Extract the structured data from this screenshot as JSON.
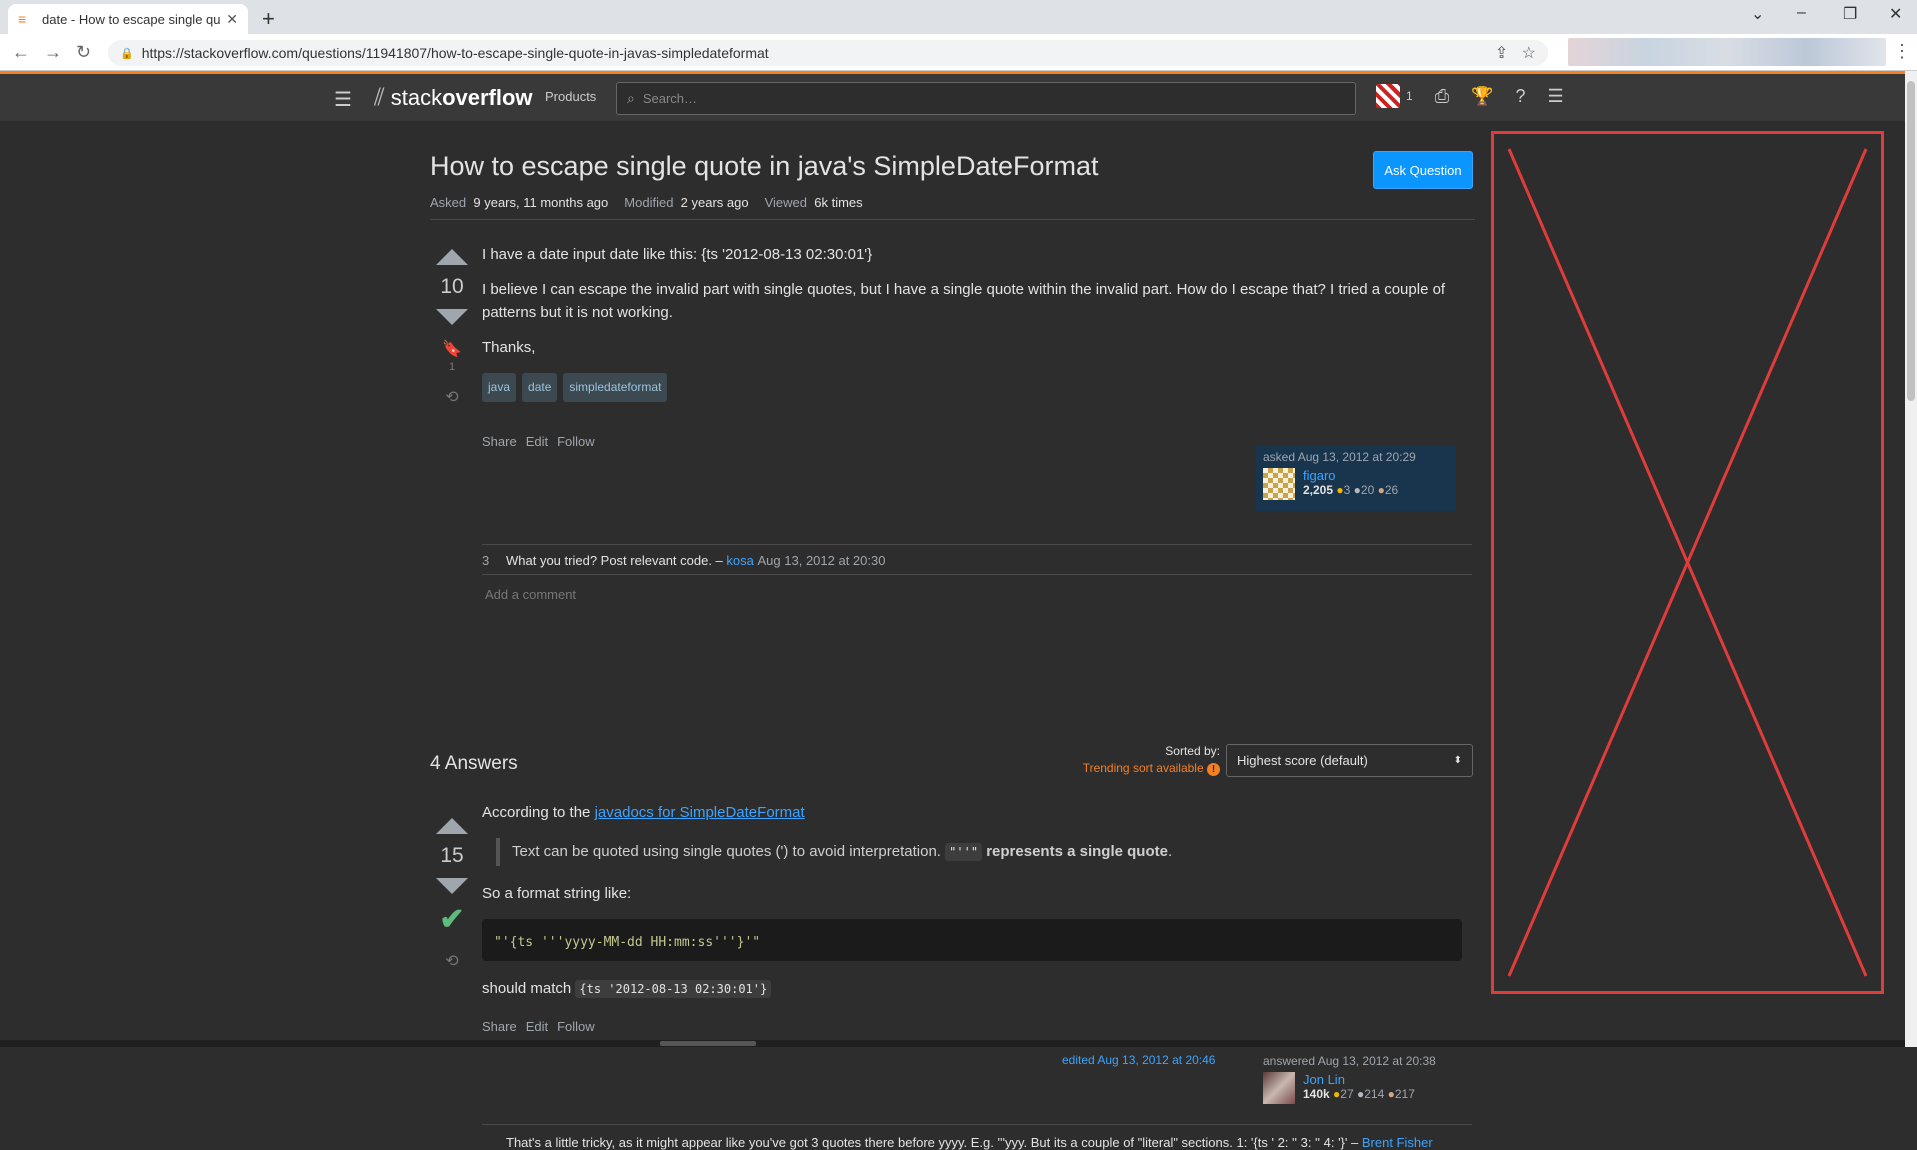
{
  "browser": {
    "tab_title": "date - How to escape single quo",
    "url": "https://stackoverflow.com/questions/11941807/how-to-escape-single-quote-in-javas-simpledateformat"
  },
  "header": {
    "logo_text_light": "stack",
    "logo_text_bold": "overflow",
    "products_label": "Products",
    "search_placeholder": "Search…",
    "reputation": "1"
  },
  "question": {
    "title": "How to escape single quote in java's SimpleDateFormat",
    "ask_button": "Ask Question",
    "asked_label": "Asked",
    "asked_value": "9 years, 11 months ago",
    "modified_label": "Modified",
    "modified_value": "2 years ago",
    "viewed_label": "Viewed",
    "viewed_value": "6k times",
    "score": "10",
    "bookmark_count": "1",
    "body_p1": "I have a date input date like this: {ts '2012-08-13 02:30:01'}",
    "body_p2": "I believe I can escape the invalid part with single quotes, but I have a single quote within the invalid part. How do I escape that? I tried a couple of patterns but it is not working.",
    "body_p3": "Thanks,",
    "tags": [
      "java",
      "date",
      "simpledateformat"
    ],
    "menu": {
      "share": "Share",
      "edit": "Edit",
      "follow": "Follow"
    },
    "owner": {
      "action": "asked Aug 13, 2012 at 20:29",
      "name": "figaro",
      "rep": "2,205",
      "gold": "3",
      "silver": "20",
      "bronze": "26"
    },
    "comment": {
      "score": "3",
      "text": "What you tried? Post relevant code. –",
      "user": "kosa",
      "date": "Aug 13, 2012 at 20:30"
    },
    "add_comment": "Add a comment"
  },
  "answers": {
    "count_label": "4 Answers",
    "sorted_by_label": "Sorted by:",
    "trending_label": "Trending sort available",
    "sort_value": "Highest score (default)"
  },
  "answer1": {
    "score": "15",
    "intro": "According to the ",
    "link": "javadocs for SimpleDateFormat",
    "quote_text": "Text can be quoted using single quotes (') to avoid interpretation. ",
    "quote_code": "\"''\"",
    "quote_bold": "represents a single quote",
    "quote_end": ".",
    "format_intro": "So a format string like:",
    "code": "\"'{ts '''yyyy-MM-dd HH:mm:ss'''}'\"",
    "match_text": "should match ",
    "match_code": "{ts '2012-08-13 02:30:01'}",
    "menu": {
      "share": "Share",
      "edit": "Edit",
      "follow": "Follow"
    },
    "edited": "edited Aug 13, 2012 at 20:46",
    "owner": {
      "action": "answered Aug 13, 2012 at 20:38",
      "name": "Jon Lin",
      "rep": "140k",
      "gold": "27",
      "silver": "214",
      "bronze": "217"
    },
    "comment": {
      "text": "That's a little tricky, as it might appear like you've got 3 quotes there before yyyy. E.g. '''yyy. But its a couple of \"literal\" sections. 1: '{ts ' 2: '' 3: '' 4: '}' –",
      "user": "Brent Fisher"
    }
  },
  "colors": {
    "accent": "#f48024",
    "link": "#3ca4ff",
    "ask_button": "#0a95ff",
    "accepted": "#5eba7d",
    "ad_outline": "#e13c3c"
  }
}
